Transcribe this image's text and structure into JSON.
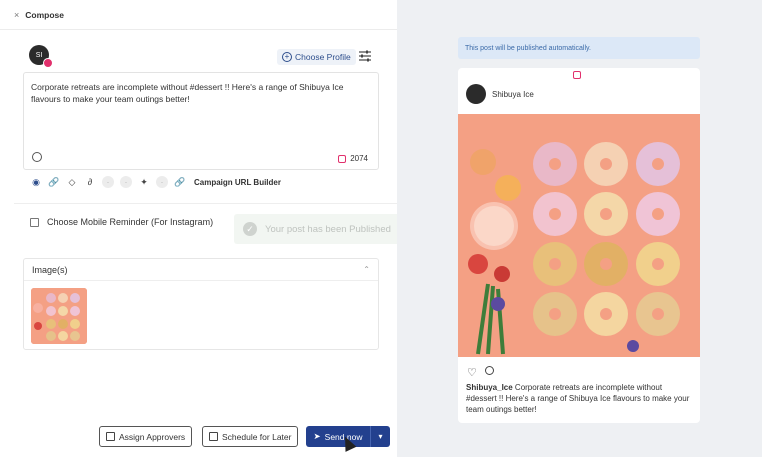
{
  "header": {
    "close_icon": "×",
    "title": "Compose"
  },
  "profile": {
    "avatar_text": "SI",
    "choose_profile_label": "Choose Profile"
  },
  "editor": {
    "text": "Corporate retreats are incomplete without #dessert !! Here's a range of Shibuya Ice flavours to make your team outings better!",
    "char_count": "2074"
  },
  "toolbar": {
    "campaign_url_label": "Campaign URL Builder"
  },
  "reminder": {
    "label": "Choose Mobile Reminder (For Instagram)",
    "checked": false
  },
  "images": {
    "title": "Image(s)"
  },
  "actions": {
    "assign_label": "Assign Approvers",
    "schedule_label": "Schedule for Later",
    "send_label": "Send now"
  },
  "toast": {
    "text": "Your post has been Published"
  },
  "preview": {
    "notice": "This post will be published automatically.",
    "username": "Shibuya Ice",
    "caption_user": "Shibuya_Ice",
    "caption_text": " Corporate retreats are incomplete without #dessert !! Here's a range of Shibuya Ice flavours to make your team outings better!"
  },
  "colors": {
    "primary": "#23408e",
    "instagram": "#e1306c",
    "background_right": "#eef0f3"
  }
}
